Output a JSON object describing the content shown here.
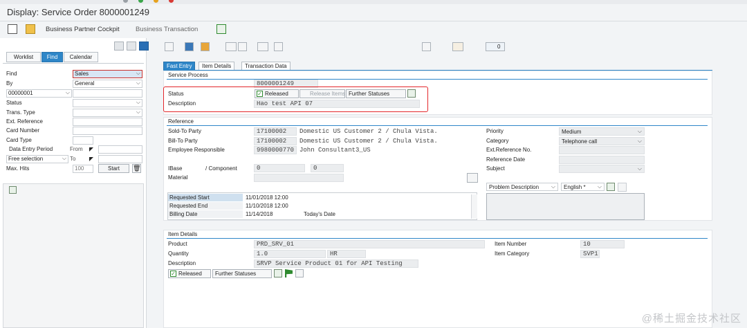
{
  "window": {
    "title": "Display: Service Order 8000001249"
  },
  "toolbar": {
    "cockpit_label": "Business Partner Cockpit",
    "transaction_label": "Business Transaction"
  },
  "left_panel": {
    "tabs": [
      "Worklist",
      "Find",
      "Calendar"
    ],
    "active_tab": "Find",
    "fields": {
      "find_label": "Find",
      "find_value": "Sales",
      "by_label": "By",
      "by_value": "General",
      "id_value": "00000001",
      "status_label": "Status",
      "trans_type_label": "Trans. Type",
      "ext_ref_label": "Ext. Reference",
      "card_number_label": "Card Number",
      "card_type_label": "Card Type",
      "data_entry_label": "Data Entry Period",
      "from_label": "From",
      "free_selection_value": "Free selection",
      "to_label": "To",
      "max_hits_label": "Max. Hits",
      "max_hits_value": "100",
      "start_button": "Start"
    }
  },
  "main": {
    "tabs": [
      "Fast Entry",
      "Item Details",
      "Transaction Data"
    ],
    "active_tab": "Fast Entry",
    "service_process": {
      "title": "Service Process",
      "order_number": "8000001249",
      "status_label": "Status",
      "status_value": "Released",
      "release_items": "Release Items",
      "further_statuses": "Further Statuses",
      "description_label": "Description",
      "description_value": "Hao test API 07"
    },
    "reference": {
      "title": "Reference",
      "sold_to_label": "Sold-To Party",
      "sold_to_id": "17100002",
      "sold_to_name": "Domestic US Customer 2 / Chula Vista.",
      "bill_to_label": "Bill-To Party",
      "bill_to_id": "17100002",
      "bill_to_name": "Domestic US Customer 2 / Chula Vista.",
      "employee_label": "Employee Responsible",
      "employee_id": "9980000770",
      "employee_name": "John Consultant3_US",
      "ibase_label": "IBase",
      "component_label": "/ Component",
      "ibase_value": "0",
      "component_value": "0",
      "material_label": "Material",
      "priority_label": "Priority",
      "priority_value": "Medium",
      "category_label": "Category",
      "category_value": "Telephone call",
      "ext_ref_label": "Ext.Reference No.",
      "ref_date_label": "Reference Date",
      "subject_label": "Subject",
      "problem_desc": "Problem Description",
      "language": "English *",
      "dates": [
        {
          "label": "Requested Start",
          "value": "11/01/2018 12:00",
          "extra": ""
        },
        {
          "label": "Requested End",
          "value": "11/10/2018 12:00",
          "extra": ""
        },
        {
          "label": "Billing Date",
          "value": "11/14/2018",
          "extra": "Today's Date"
        }
      ]
    },
    "item_details": {
      "title": "Item Details",
      "product_label": "Product",
      "product_value": "PRD_SRV_01",
      "quantity_label": "Quantity",
      "quantity_value": "1.0",
      "unit_value": "HR",
      "description_label": "Description",
      "description_value": "SRVP Service Product 01 for API Testing",
      "status_value": "Released",
      "further_statuses": "Further Statuses",
      "item_number_label": "Item Number",
      "item_number_value": "10",
      "item_category_label": "Item Category",
      "item_category_value": "SVP1"
    }
  },
  "watermark": "@稀土掘金技术社区",
  "colors": {
    "accent": "#2e86c8",
    "highlight": "#e3262a",
    "status_green": "#2f8a2f"
  }
}
